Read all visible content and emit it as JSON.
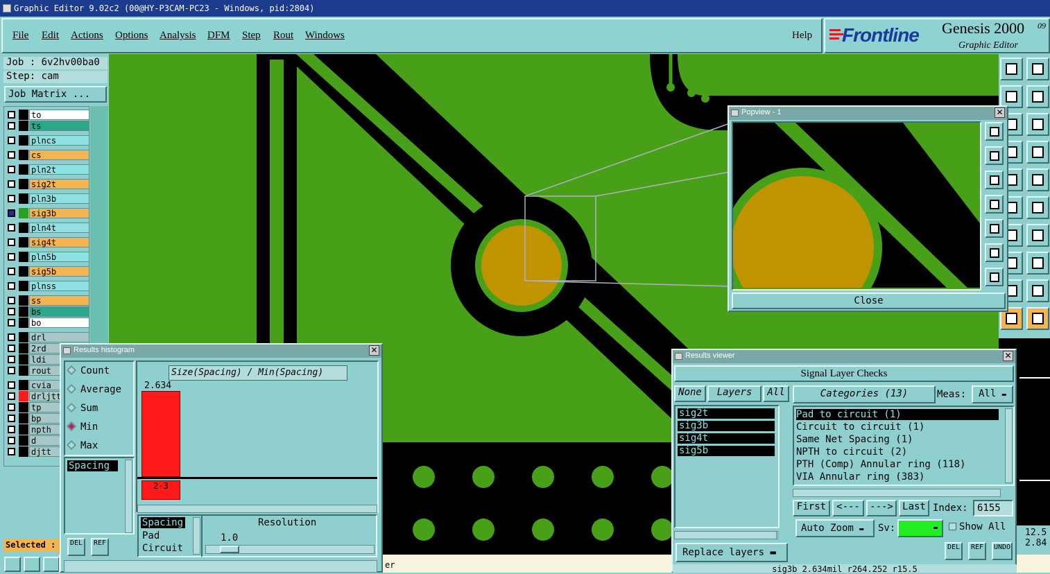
{
  "window": {
    "title": "Graphic Editor 9.02c2 (00@HY-P3CAM-PC23 - Windows, pid:2804)"
  },
  "menu": {
    "items": [
      "File",
      "Edit",
      "Actions",
      "Options",
      "Analysis",
      "DFM",
      "Step",
      "Rout",
      "Windows"
    ],
    "help": "Help"
  },
  "brand": {
    "logo": "Frontline",
    "product": "Genesis 2000",
    "version": "09",
    "subtitle": "Graphic Editor"
  },
  "job": {
    "job_line": "Job : 6v2hv00ba0",
    "step_line": "Step: cam",
    "matrix_button": "Job Matrix ..."
  },
  "layers": [
    {
      "name": "to",
      "color": "#ffffff"
    },
    {
      "name": "ts",
      "color": "#2aa88a"
    },
    {
      "name": "plncs",
      "color": "#8fe0e0"
    },
    {
      "name": "cs",
      "color": "#f4b450"
    },
    {
      "name": "pln2t",
      "color": "#8fe0e0"
    },
    {
      "name": "sig2t",
      "color": "#f4b450"
    },
    {
      "name": "pln3b",
      "color": "#8fe0e0"
    },
    {
      "name": "sig3b",
      "color": "#f4b450"
    },
    {
      "name": "pln4t",
      "color": "#8fe0e0"
    },
    {
      "name": "sig4t",
      "color": "#f4b450"
    },
    {
      "name": "pln5b",
      "color": "#8fe0e0"
    },
    {
      "name": "sig5b",
      "color": "#f4b450"
    },
    {
      "name": "plnss",
      "color": "#8fe0e0"
    },
    {
      "name": "ss",
      "color": "#f4b450"
    },
    {
      "name": "bs",
      "color": "#2aa88a"
    },
    {
      "name": "bo",
      "color": "#ffffff"
    },
    {
      "name": "drl",
      "color": "#a8c8c8"
    },
    {
      "name": "2rd",
      "color": "#a8c8c8"
    },
    {
      "name": "ldi",
      "color": "#a8c8c8"
    },
    {
      "name": "rout",
      "color": "#a8c8c8"
    },
    {
      "name": "cvia",
      "color": "#a8c8c8"
    },
    {
      "name": "drljtt",
      "color": "#a8c8c8"
    },
    {
      "name": "tp",
      "color": "#a8c8c8"
    },
    {
      "name": "bp",
      "color": "#a8c8c8"
    },
    {
      "name": "npth",
      "color": "#a8c8c8"
    },
    {
      "name": "d",
      "color": "#a8c8c8"
    },
    {
      "name": "djtt",
      "color": "#a8c8c8"
    }
  ],
  "status": {
    "selected_label": "Selected :",
    "bottom_text": "er"
  },
  "popview": {
    "title": "Popview - 1",
    "close": "Close"
  },
  "histogram": {
    "title": "Results histogram",
    "modes": [
      "Count",
      "Average",
      "Sum",
      "Min",
      "Max"
    ],
    "selected_mode": "Min",
    "left_list": [
      "Spacing"
    ],
    "header": "Size(Spacing) / Min(Spacing)",
    "bar_label": "2.634",
    "bar_value": 2.634,
    "bar_fraction": 0.95,
    "bin_label": "2-3",
    "type_list": [
      "Spacing",
      "Pad",
      "Circuit"
    ],
    "resolution_label": "Resolution",
    "resolution_value": "1.0",
    "del": "DEL",
    "ref": "REF"
  },
  "results": {
    "title": "Results viewer",
    "header": "Signal Layer Checks",
    "none": "None",
    "layers_btn": "Layers",
    "all": "All",
    "layers": [
      "sig2t",
      "sig3b",
      "sig4t",
      "sig5b"
    ],
    "categories_btn": "Categories (13)",
    "meas_label": "Meas:",
    "meas_value": "All",
    "categories": [
      "Pad to circuit (1)",
      "Circuit to circuit (1)",
      "Same Net Spacing (1)",
      "NPTH to circuit (2)",
      "PTH (Comp) Annular ring (118)",
      "VIA Annular ring (383)"
    ],
    "first": "First",
    "prev": "<---",
    "next": "--->",
    "last": "Last",
    "index_label": "Index:",
    "index_value": "6155",
    "auto_zoom": "Auto Zoom",
    "sv_label": "Sv:",
    "show_all": "Show All",
    "replace_layers": "Replace layers",
    "del": "DEL",
    "ref": "REF",
    "undo": "UNDO",
    "status_line": "sig3b 2.634mil r264.252 r15.5"
  },
  "right_readout": {
    "line1": "12.5",
    "line2": "2.84"
  },
  "colors": {
    "board_green": "#48a018",
    "copper": "#bf9400",
    "bar_red": "#ff1a1a",
    "panel": "#8fcfcf"
  }
}
